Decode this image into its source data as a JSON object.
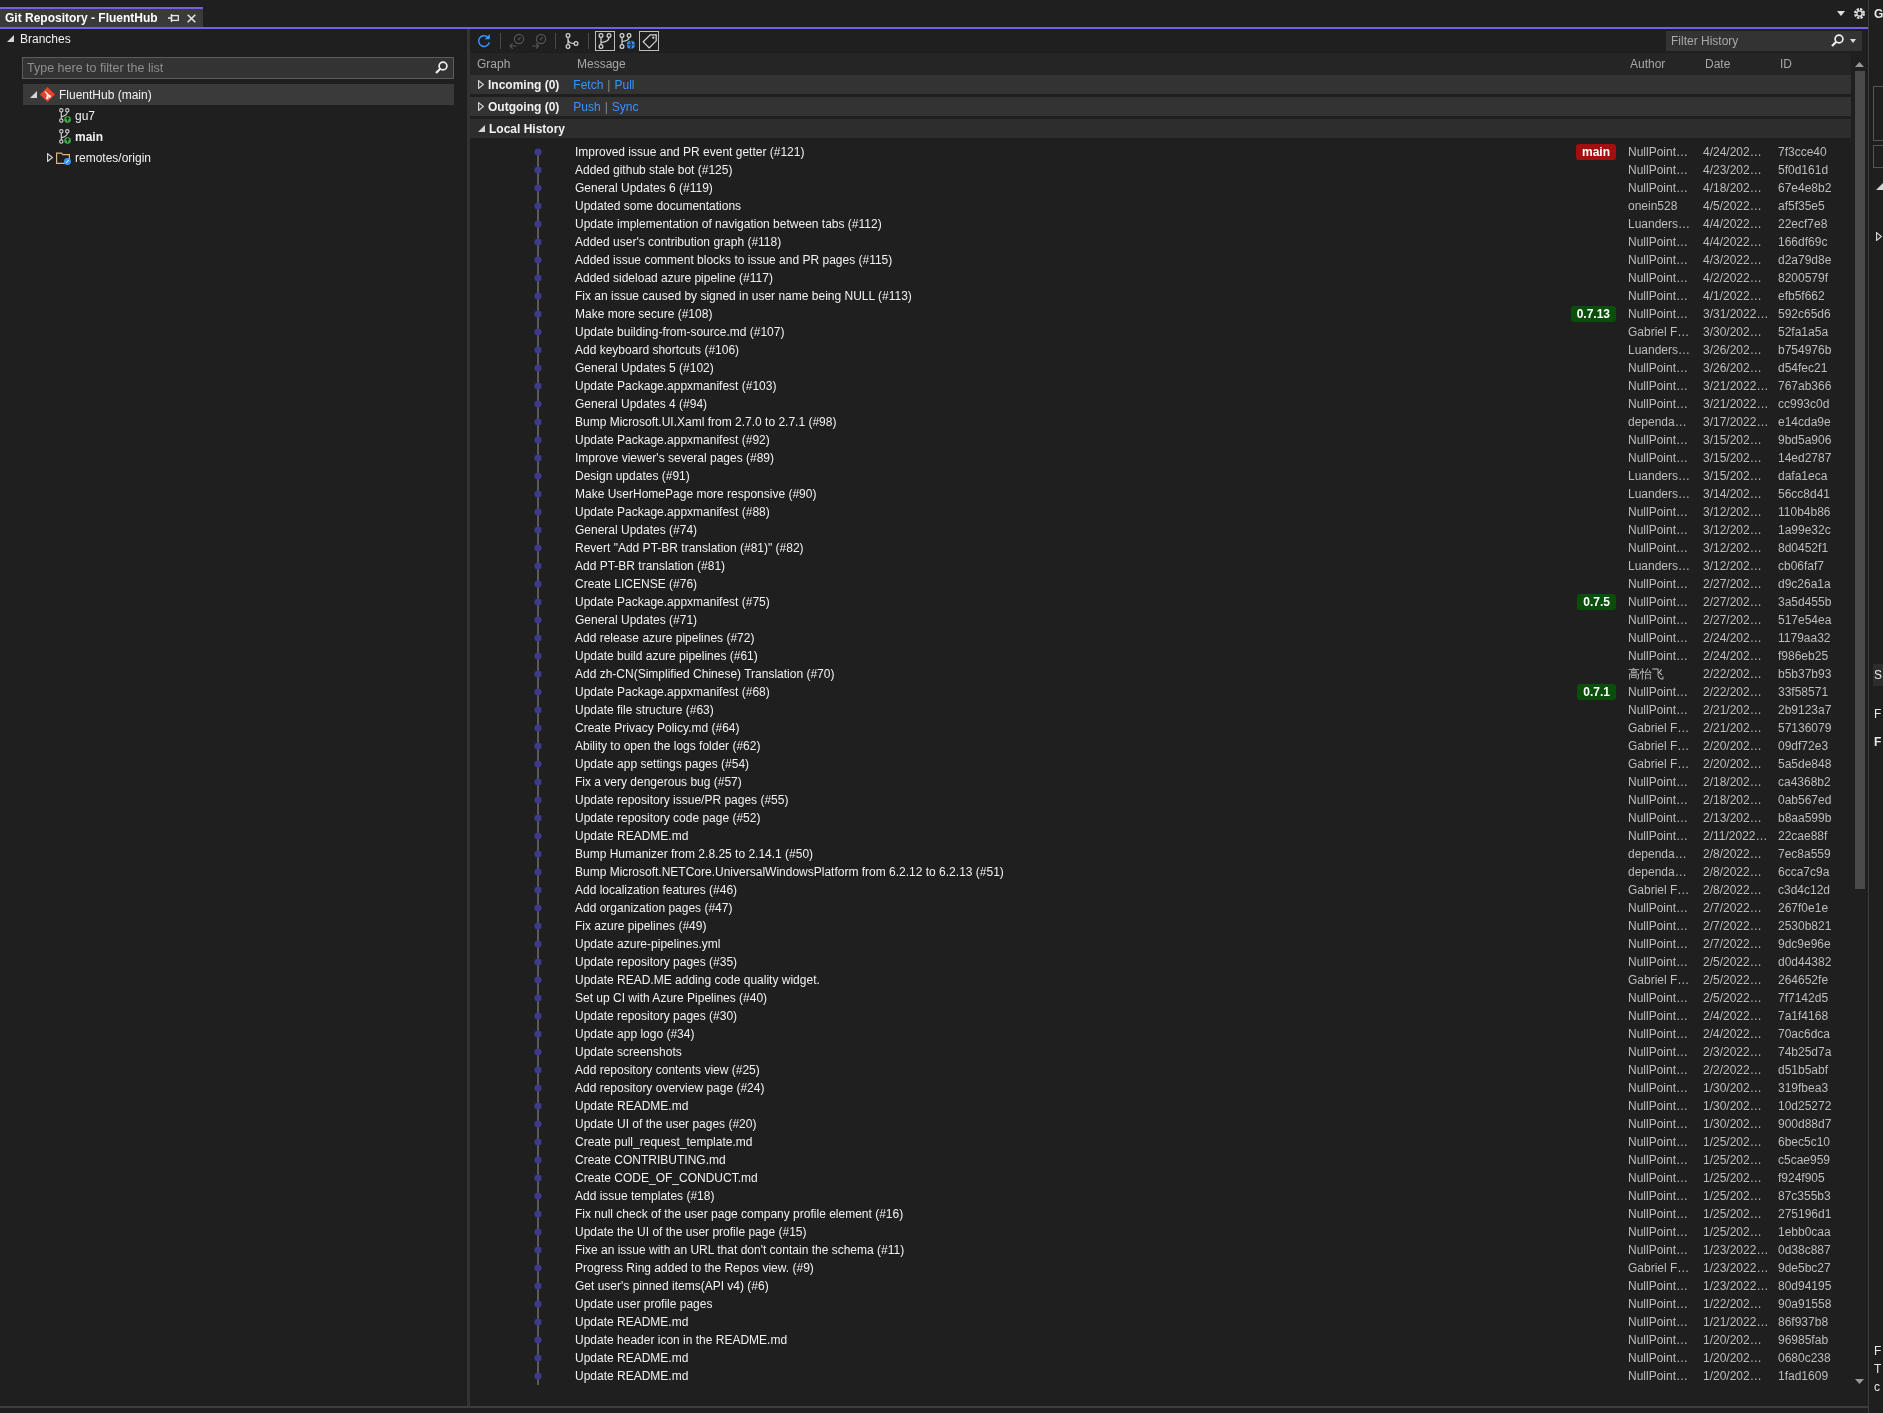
{
  "window": {
    "tab_title": "Git Repository - FluentHub"
  },
  "branches_panel": {
    "title": "Branches",
    "expanded": true,
    "filter": {
      "placeholder": "Type here to filter the list"
    },
    "tree": [
      {
        "label": "FluentHub (main)",
        "kind": "repo",
        "expanded": true,
        "selected": true,
        "current": false,
        "children": [
          {
            "label": "gu7",
            "kind": "branch",
            "selected": false,
            "current": false
          },
          {
            "label": "main",
            "kind": "branch",
            "selected": false,
            "current": true
          },
          {
            "label": "remotes/origin",
            "kind": "remote",
            "expanded": false,
            "selected": false,
            "current": false
          }
        ]
      }
    ]
  },
  "history": {
    "toolbar": [
      [
        {
          "kind": "refresh",
          "disabled": false,
          "on": false
        }
      ],
      [
        {
          "kind": "fetch",
          "disabled": true,
          "on": false
        },
        {
          "kind": "pull",
          "disabled": true,
          "on": false
        }
      ],
      [
        {
          "kind": "graph",
          "disabled": false,
          "on": false
        }
      ],
      [
        {
          "kind": "local-branches",
          "disabled": false,
          "on": true
        },
        {
          "kind": "remote-branches",
          "disabled": false,
          "on": false
        },
        {
          "kind": "tags",
          "disabled": false,
          "on": true
        }
      ]
    ],
    "filter": {
      "placeholder": "Filter History"
    },
    "columns": [
      "Graph",
      "Message",
      "Author",
      "Date",
      "ID"
    ],
    "sections": [
      {
        "label": "Incoming (0)",
        "expanded": false,
        "links": [
          "Fetch",
          "Pull"
        ],
        "separator": "|"
      },
      {
        "label": "Outgoing (0)",
        "expanded": false,
        "links": [
          "Push",
          "Sync"
        ],
        "separator": "|"
      },
      {
        "label": "Local History",
        "expanded": true
      }
    ],
    "commits": [
      {
        "message": "Improved issue and PR event getter (#121)",
        "tags": [
          {
            "label": "main",
            "color": "#a30f0f"
          }
        ],
        "author": "NullPoint…",
        "date": "4/24/202…",
        "id": "7f3cce40"
      },
      {
        "message": "Added github stale bot (#125)",
        "author": "NullPoint…",
        "date": "4/23/202…",
        "id": "5f0d161d"
      },
      {
        "message": "General Updates 6 (#119)",
        "author": "NullPoint…",
        "date": "4/18/202…",
        "id": "67e4e8b2"
      },
      {
        "message": "Updated some documentations",
        "author": "onein528",
        "date": "4/5/2022…",
        "id": "af5f35e5"
      },
      {
        "message": "Update implementation of navigation between tabs (#112)",
        "author": "Luanders…",
        "date": "4/4/2022…",
        "id": "22ecf7e8"
      },
      {
        "message": "Added user's contribution graph (#118)",
        "author": "NullPoint…",
        "date": "4/4/2022…",
        "id": "166df69c"
      },
      {
        "message": "Added issue comment blocks to issue and PR pages (#115)",
        "author": "NullPoint…",
        "date": "4/3/2022…",
        "id": "d2a79d8e"
      },
      {
        "message": "Added sideload azure pipeline (#117)",
        "author": "NullPoint…",
        "date": "4/2/2022…",
        "id": "8200579f"
      },
      {
        "message": "Fix an issue caused by signed in user name being NULL (#113)",
        "author": "NullPoint…",
        "date": "4/1/2022…",
        "id": "efb5f662"
      },
      {
        "message": "Make more secure (#108)",
        "tags": [
          {
            "label": "0.7.13",
            "color": "#0b4d0b"
          }
        ],
        "author": "NullPoint…",
        "date": "3/31/2022…",
        "id": "592c65d6"
      },
      {
        "message": "Update building-from-source.md (#107)",
        "author": "Gabriel F…",
        "date": "3/30/202…",
        "id": "52fa1a5a"
      },
      {
        "message": "Add keyboard shortcuts (#106)",
        "author": "Luanders…",
        "date": "3/26/202…",
        "id": "b754976b"
      },
      {
        "message": "General Updates 5 (#102)",
        "author": "NullPoint…",
        "date": "3/26/202…",
        "id": "d54fec21"
      },
      {
        "message": "Update Package.appxmanifest (#103)",
        "author": "NullPoint…",
        "date": "3/21/2022…",
        "id": "767ab366"
      },
      {
        "message": "General Updates 4 (#94)",
        "author": "NullPoint…",
        "date": "3/21/2022…",
        "id": "cc993c0d"
      },
      {
        "message": "Bump Microsoft.UI.Xaml from 2.7.0 to 2.7.1 (#98)",
        "author": "dependa…",
        "date": "3/17/2022…",
        "id": "e14cda9e"
      },
      {
        "message": "Update Package.appxmanifest (#92)",
        "author": "NullPoint…",
        "date": "3/15/202…",
        "id": "9bd5a906"
      },
      {
        "message": "Improve viewer's several pages (#89)",
        "author": "NullPoint…",
        "date": "3/15/202…",
        "id": "14ed2787"
      },
      {
        "message": "Design updates (#91)",
        "author": "Luanders…",
        "date": "3/15/202…",
        "id": "dafa1eca"
      },
      {
        "message": "Make UserHomePage more responsive (#90)",
        "author": "Luanders…",
        "date": "3/14/202…",
        "id": "56cc8d41"
      },
      {
        "message": "Update Package.appxmanifest (#88)",
        "author": "NullPoint…",
        "date": "3/12/202…",
        "id": "110b4b86"
      },
      {
        "message": "General Updates (#74)",
        "author": "NullPoint…",
        "date": "3/12/202…",
        "id": "1a99e32c"
      },
      {
        "message": "Revert \"Add PT-BR translation (#81)\" (#82)",
        "author": "NullPoint…",
        "date": "3/12/202…",
        "id": "8d0452f1"
      },
      {
        "message": "Add PT-BR translation (#81)",
        "author": "Luanders…",
        "date": "3/12/202…",
        "id": "cb06faf7"
      },
      {
        "message": "Create LICENSE (#76)",
        "author": "NullPoint…",
        "date": "2/27/202…",
        "id": "d9c26a1a"
      },
      {
        "message": "Update Package.appxmanifest (#75)",
        "tags": [
          {
            "label": "0.7.5",
            "color": "#0b4d0b"
          }
        ],
        "author": "NullPoint…",
        "date": "2/27/202…",
        "id": "3a5d455b"
      },
      {
        "message": "General Updates (#71)",
        "author": "NullPoint…",
        "date": "2/27/202…",
        "id": "517e54ea"
      },
      {
        "message": "Add release azure pipelines (#72)",
        "author": "NullPoint…",
        "date": "2/24/202…",
        "id": "1179aa32"
      },
      {
        "message": "Update build azure pipelines (#61)",
        "author": "NullPoint…",
        "date": "2/24/202…",
        "id": "f986eb25"
      },
      {
        "message": "Add zh-CN(Simplified Chinese) Translation (#70)",
        "author": "高怡飞",
        "date": "2/22/202…",
        "id": "b5b37b93"
      },
      {
        "message": "Update Package.appxmanifest (#68)",
        "tags": [
          {
            "label": "0.7.1",
            "color": "#0b4d0b"
          }
        ],
        "author": "NullPoint…",
        "date": "2/22/202…",
        "id": "33f58571"
      },
      {
        "message": "Update file structure (#63)",
        "author": "NullPoint…",
        "date": "2/21/202…",
        "id": "2b9123a7"
      },
      {
        "message": "Create Privacy Policy.md (#64)",
        "author": "Gabriel F…",
        "date": "2/21/202…",
        "id": "57136079"
      },
      {
        "message": "Ability to open the logs folder (#62)",
        "author": "Gabriel F…",
        "date": "2/20/202…",
        "id": "09df72e3"
      },
      {
        "message": "Update app settings pages (#54)",
        "author": "Gabriel F…",
        "date": "2/20/202…",
        "id": "5a5de848"
      },
      {
        "message": "Fix a very dengerous bug (#57)",
        "author": "NullPoint…",
        "date": "2/18/202…",
        "id": "ca4368b2"
      },
      {
        "message": "Update repository issue/PR pages (#55)",
        "author": "NullPoint…",
        "date": "2/18/202…",
        "id": "0ab567ed"
      },
      {
        "message": "Update repository code page (#52)",
        "author": "NullPoint…",
        "date": "2/13/202…",
        "id": "b8aa599b"
      },
      {
        "message": "Update README.md",
        "author": "NullPoint…",
        "date": "2/11/2022…",
        "id": "22cae88f"
      },
      {
        "message": "Bump Humanizer from 2.8.25 to 2.14.1 (#50)",
        "author": "dependa…",
        "date": "2/8/2022…",
        "id": "7ec8a559"
      },
      {
        "message": "Bump Microsoft.NETCore.UniversalWindowsPlatform from 6.2.12 to 6.2.13 (#51)",
        "author": "dependa…",
        "date": "2/8/2022…",
        "id": "6cca7c9a"
      },
      {
        "message": "Add localization features (#46)",
        "author": "Gabriel F…",
        "date": "2/8/2022…",
        "id": "c3d4c12d"
      },
      {
        "message": "Add organization pages (#47)",
        "author": "NullPoint…",
        "date": "2/7/2022…",
        "id": "267f0e1e"
      },
      {
        "message": "Fix azure pipelines (#49)",
        "author": "NullPoint…",
        "date": "2/7/2022…",
        "id": "2530b821"
      },
      {
        "message": "Update azure-pipelines.yml",
        "author": "NullPoint…",
        "date": "2/7/2022…",
        "id": "9dc9e96e"
      },
      {
        "message": "Update repository pages (#35)",
        "author": "NullPoint…",
        "date": "2/5/2022…",
        "id": "d0d44382"
      },
      {
        "message": "Update READ.ME adding code quality widget.",
        "author": "Gabriel F…",
        "date": "2/5/2022…",
        "id": "264652fe"
      },
      {
        "message": "Set up CI with Azure Pipelines (#40)",
        "author": "NullPoint…",
        "date": "2/5/2022…",
        "id": "7f7142d5"
      },
      {
        "message": "Update repository pages (#30)",
        "author": "NullPoint…",
        "date": "2/4/2022…",
        "id": "7a1f4168"
      },
      {
        "message": "Update app logo (#34)",
        "author": "NullPoint…",
        "date": "2/4/2022…",
        "id": "70ac6dca"
      },
      {
        "message": "Update screenshots",
        "author": "NullPoint…",
        "date": "2/3/2022…",
        "id": "74b25d7a"
      },
      {
        "message": "Add repository contents view (#25)",
        "author": "NullPoint…",
        "date": "2/2/2022…",
        "id": "d51b5abf"
      },
      {
        "message": "Add repository overview page (#24)",
        "author": "NullPoint…",
        "date": "1/30/202…",
        "id": "319fbea3"
      },
      {
        "message": "Update README.md",
        "author": "NullPoint…",
        "date": "1/30/202…",
        "id": "10d25272"
      },
      {
        "message": "Update UI of the user pages (#20)",
        "author": "NullPoint…",
        "date": "1/30/202…",
        "id": "900d88d7"
      },
      {
        "message": "Create pull_request_template.md",
        "author": "NullPoint…",
        "date": "1/25/202…",
        "id": "6bec5c10"
      },
      {
        "message": "Create CONTRIBUTING.md",
        "author": "NullPoint…",
        "date": "1/25/202…",
        "id": "c5cae959"
      },
      {
        "message": "Create CODE_OF_CONDUCT.md",
        "author": "NullPoint…",
        "date": "1/25/202…",
        "id": "f924f905"
      },
      {
        "message": "Add issue templates (#18)",
        "author": "NullPoint…",
        "date": "1/25/202…",
        "id": "87c355b3"
      },
      {
        "message": "Fix null check of the user page company profile element (#16)",
        "author": "NullPoint…",
        "date": "1/25/202…",
        "id": "275196d1"
      },
      {
        "message": "Update the UI of the user profile page (#15)",
        "author": "NullPoint…",
        "date": "1/25/202…",
        "id": "1ebb0caa"
      },
      {
        "message": "Fixe an issue with an URL that don't contain the schema (#11)",
        "author": "NullPoint…",
        "date": "1/23/2022…",
        "id": "0d38c887"
      },
      {
        "message": "Progress Ring added to the Repos view. (#9)",
        "author": "Gabriel F…",
        "date": "1/23/2022…",
        "id": "9de5bc27"
      },
      {
        "message": "Get user's pinned items(API v4) (#6)",
        "author": "NullPoint…",
        "date": "1/23/2022…",
        "id": "80d94195"
      },
      {
        "message": "Update user profile pages",
        "author": "NullPoint…",
        "date": "1/22/202…",
        "id": "90a91558"
      },
      {
        "message": "Update README.md",
        "author": "NullPoint…",
        "date": "1/21/2022…",
        "id": "86f937b8"
      },
      {
        "message": "Update header icon in the README.md",
        "author": "NullPoint…",
        "date": "1/20/202…",
        "id": "96985fab"
      },
      {
        "message": "Update README.md",
        "author": "NullPoint…",
        "date": "1/20/202…",
        "id": "0680c238"
      },
      {
        "message": "Update README.md",
        "author": "NullPoint…",
        "date": "1/20/202…",
        "id": "1fad1609"
      }
    ]
  },
  "side_panel": {
    "tab_title": "G",
    "sections": [
      {
        "expanded": true
      },
      {
        "expanded": false
      }
    ],
    "lower_panel": {
      "tab_title": "S",
      "items": [
        {
          "text": "F",
          "kind": "plain"
        },
        {
          "text": "F",
          "kind": "bold"
        }
      ]
    },
    "footer": [
      "F",
      "T",
      "c"
    ]
  }
}
